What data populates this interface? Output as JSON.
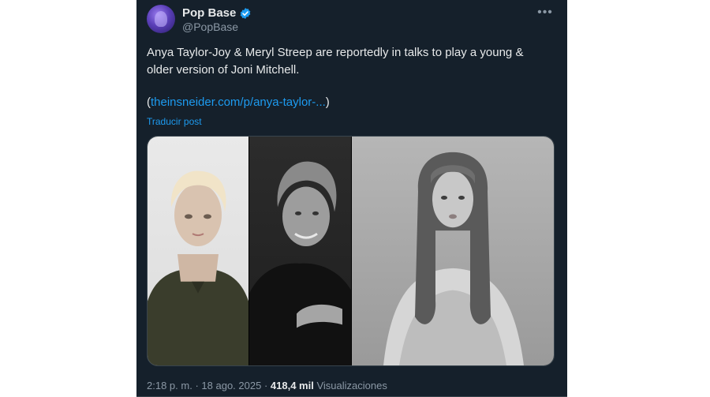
{
  "post": {
    "author": {
      "name": "Pop Base",
      "handle": "@PopBase",
      "verified": true
    },
    "text_lines": [
      "Anya Taylor-Joy & Meryl Streep are reportedly in talks to play a young &",
      "older version of Joni Mitchell."
    ],
    "link": {
      "open": "(",
      "text": "theinsneider.com/p/anya-taylor-...",
      "close": ")"
    },
    "translate_label": "Traducir post",
    "meta": {
      "time": "2:18 p. m.",
      "separator": "·",
      "date": "18 ago. 2025",
      "views": "418,4 mil",
      "views_label": "Visualizaciones"
    }
  },
  "icons": {
    "more": "more-icon",
    "verified": "verified-badge-icon"
  },
  "colors": {
    "background": "#15202b",
    "text": "#e7e9ea",
    "muted": "#8b98a5",
    "accent": "#1d9bf0"
  }
}
